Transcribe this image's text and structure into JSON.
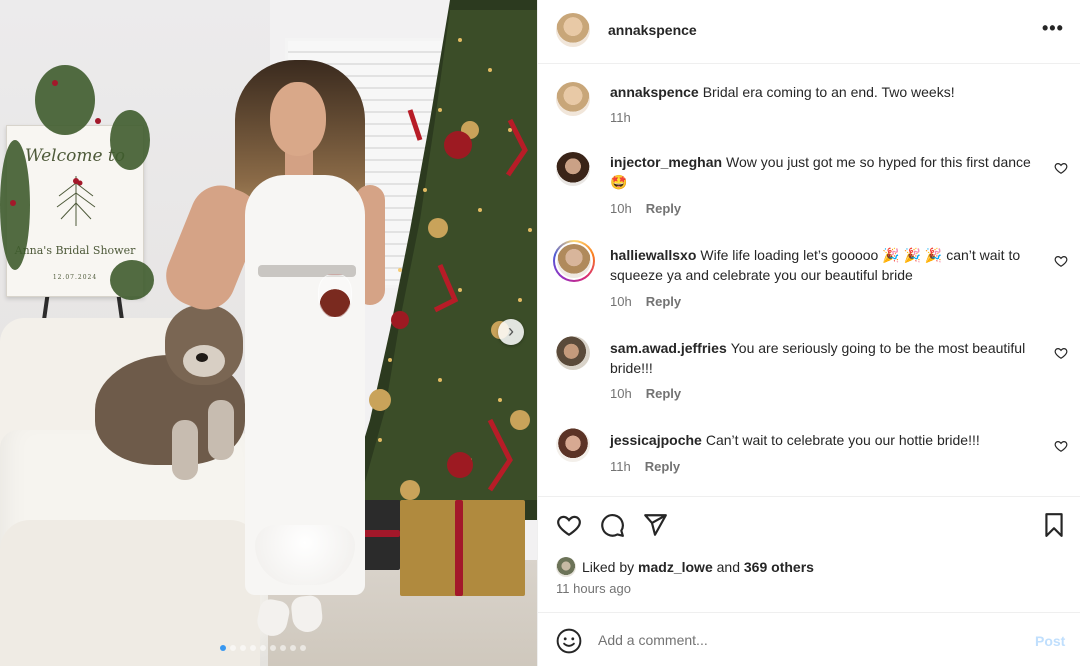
{
  "post": {
    "author": "annakspence",
    "caption": "Bridal era coming to an end. Two weeks!",
    "caption_time": "11h",
    "photo": {
      "sign_welcome": "Welcome to",
      "sign_name": "Anna's Bridal Shower",
      "sign_date": "12.07.2024",
      "carousel_count": 9,
      "carousel_active": 0
    }
  },
  "comments": [
    {
      "username": "injector_meghan",
      "text": "Wow you just got me so hyped for this first dance 🤩",
      "time": "10h",
      "reply": "Reply"
    },
    {
      "username": "halliewallsxo",
      "text": "Wife life loading let’s gooooo 🎉 🎉 🎉  can’t wait to squeeze ya and celebrate you our beautiful bride",
      "time": "10h",
      "reply": "Reply"
    },
    {
      "username": "sam.awad.jeffries",
      "text": "You are seriously going to be the most beautiful bride!!!",
      "time": "10h",
      "reply": "Reply"
    },
    {
      "username": "jessicajpoche",
      "text": "Can’t wait to celebrate you our hottie bride!!!",
      "time": "11h",
      "reply": "Reply"
    }
  ],
  "likes": {
    "prefix": "Liked by",
    "liker": "madz_lowe",
    "joiner": "and",
    "others": "369 others"
  },
  "time_ago": "11 hours ago",
  "composer": {
    "placeholder": "Add a comment...",
    "post_label": "Post"
  },
  "icons": {
    "more": "more-options-icon",
    "like": "heart-icon",
    "comment": "comment-icon",
    "share": "paper-plane-icon",
    "save": "bookmark-icon",
    "emoji": "emoji-icon",
    "next": "chevron-right-icon"
  },
  "colors": {
    "text": "#262626",
    "muted": "#737373",
    "link": "#3897f0",
    "post_disabled": "#c0dffd"
  }
}
